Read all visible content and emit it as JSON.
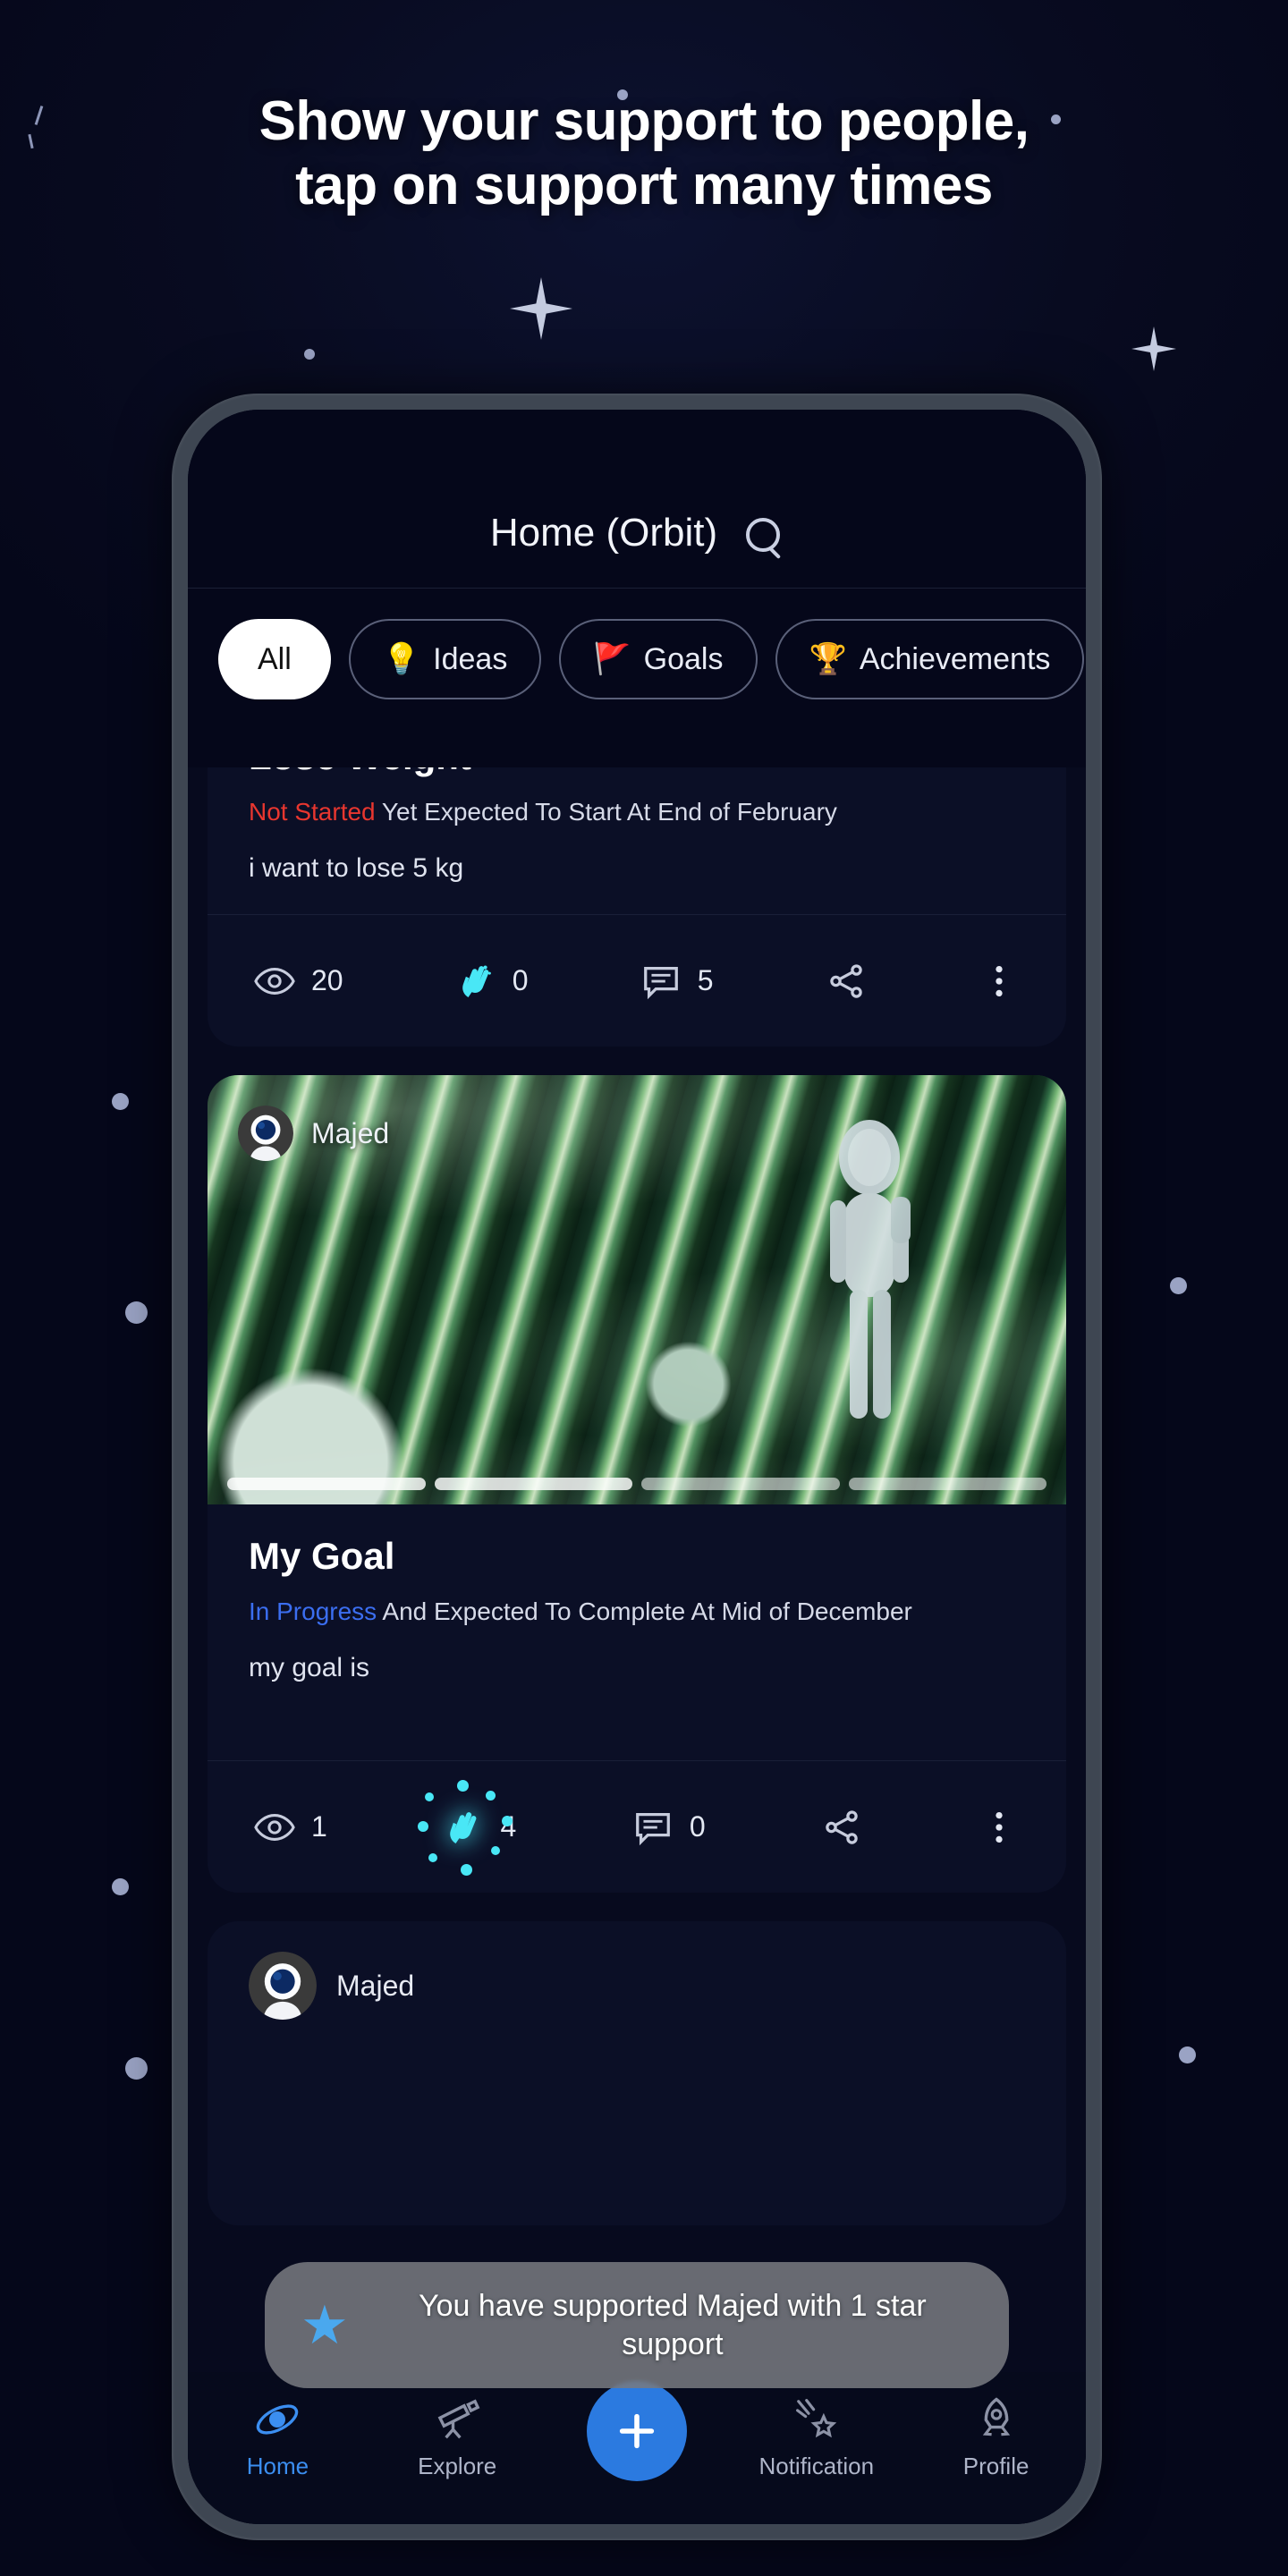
{
  "headline": {
    "line1": "Show your support to people,",
    "line2": "tap on support many times"
  },
  "phone": {
    "appbar": {
      "title": "Home (Orbit)",
      "search_icon": "search-icon"
    },
    "chips": [
      {
        "label": "All",
        "icon": "",
        "active": true
      },
      {
        "label": "Ideas",
        "icon": "💡",
        "active": false
      },
      {
        "label": "Goals",
        "icon": "🚩",
        "active": false
      },
      {
        "label": "Achievements",
        "icon": "🏆",
        "active": false
      }
    ],
    "cards": [
      {
        "title": "Lose Weight",
        "status_key": "Not Started",
        "status_rest": " Yet Expected To Start At End of February",
        "description": "i want to lose 5 kg",
        "views": "20",
        "claps": "0",
        "comments": "5"
      },
      {
        "user": "Majed",
        "title": "My Goal",
        "status_key": "In Progress",
        "status_rest": " And Expected To Complete At Mid of December",
        "description": "my goal is",
        "views": "1",
        "claps": "4",
        "comments": "0"
      },
      {
        "user": "Majed"
      }
    ],
    "toast": {
      "icon": "star-icon",
      "message": "You have supported Majed with 1 star support"
    },
    "bottomnav": [
      {
        "label": "Home",
        "icon": "home-orbit-icon",
        "active": true
      },
      {
        "label": "Explore",
        "icon": "telescope-icon",
        "active": false
      },
      {
        "label": "Notification",
        "icon": "shooting-star-icon",
        "active": false
      },
      {
        "label": "Profile",
        "icon": "rocket-icon",
        "active": false
      }
    ],
    "fab_icon": "add-satellite-icon"
  },
  "colors": {
    "background": "#070a1c",
    "accent_blue": "#3b8ef0",
    "status_red": "#e8362f",
    "status_blue": "#3b6ef0",
    "clap_cyan": "#49e7f6",
    "chip_active_bg": "#ffffff"
  }
}
